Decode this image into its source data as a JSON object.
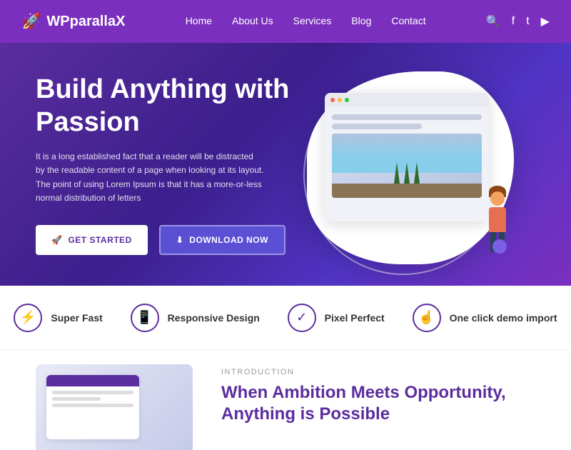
{
  "nav": {
    "logo": "WPparallaX",
    "links": [
      "Home",
      "About Us",
      "Services",
      "Blog",
      "Contact"
    ]
  },
  "hero": {
    "title_line1": "Build Anything with",
    "title_line2": "Passion",
    "description": "It is a long established fact that a reader will be distracted by the readable content of a page when looking at its layout. The point of using Lorem Ipsum is that it has a more-or-less normal distribution of letters",
    "btn_get_started": "GET STARTED",
    "btn_download": "DOWNLOAD NOW"
  },
  "features": [
    {
      "id": "super-fast",
      "label": "Super Fast",
      "icon": "⚡"
    },
    {
      "id": "responsive-design",
      "label": "Responsive Design",
      "icon": "📱"
    },
    {
      "id": "pixel-perfect",
      "label": "Pixel Perfect",
      "icon": "✓"
    },
    {
      "id": "one-click-demo",
      "label": "One click demo import",
      "icon": "👆"
    }
  ],
  "intro": {
    "section_label": "INTRODUCTION",
    "title_line1": "When Ambition Meets Opportunity,",
    "title_line2": "Anything is Possible"
  }
}
